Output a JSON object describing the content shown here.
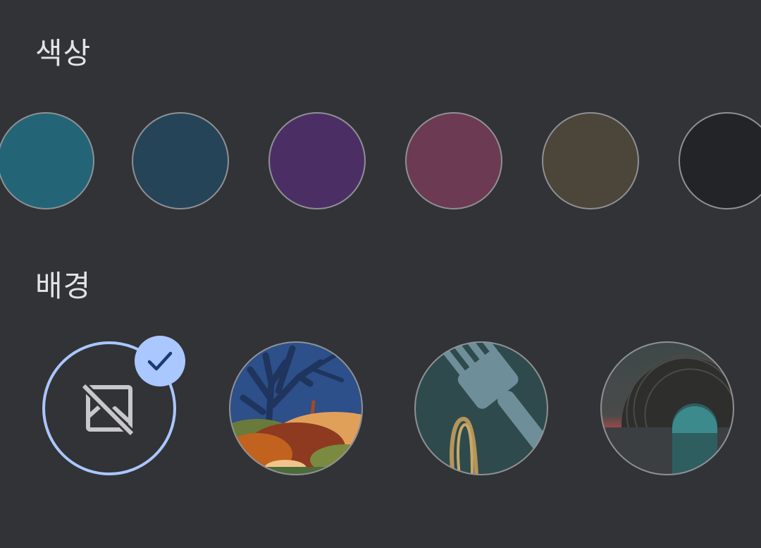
{
  "colors": {
    "title": "색상",
    "swatches": [
      {
        "name": "teal",
        "color": "#236577"
      },
      {
        "name": "slate-blue",
        "color": "#264457"
      },
      {
        "name": "purple",
        "color": "#4b2f64"
      },
      {
        "name": "wine",
        "color": "#6c3a52"
      },
      {
        "name": "taupe",
        "color": "#4c4539"
      },
      {
        "name": "charcoal",
        "color": "#232428"
      }
    ]
  },
  "background": {
    "title": "배경",
    "options": [
      {
        "name": "no-background",
        "icon": "image-off-icon",
        "selected": true
      },
      {
        "name": "tree-landscape",
        "selected": false
      },
      {
        "name": "fork-noodles",
        "selected": false
      },
      {
        "name": "tunnel-arch",
        "selected": false
      }
    ]
  },
  "theme": {
    "background": "#323337",
    "accent": "#aac7ff",
    "check_color": "#1b3a6e",
    "ring_color": "#8f9094",
    "text_color": "#e3e3e6"
  }
}
